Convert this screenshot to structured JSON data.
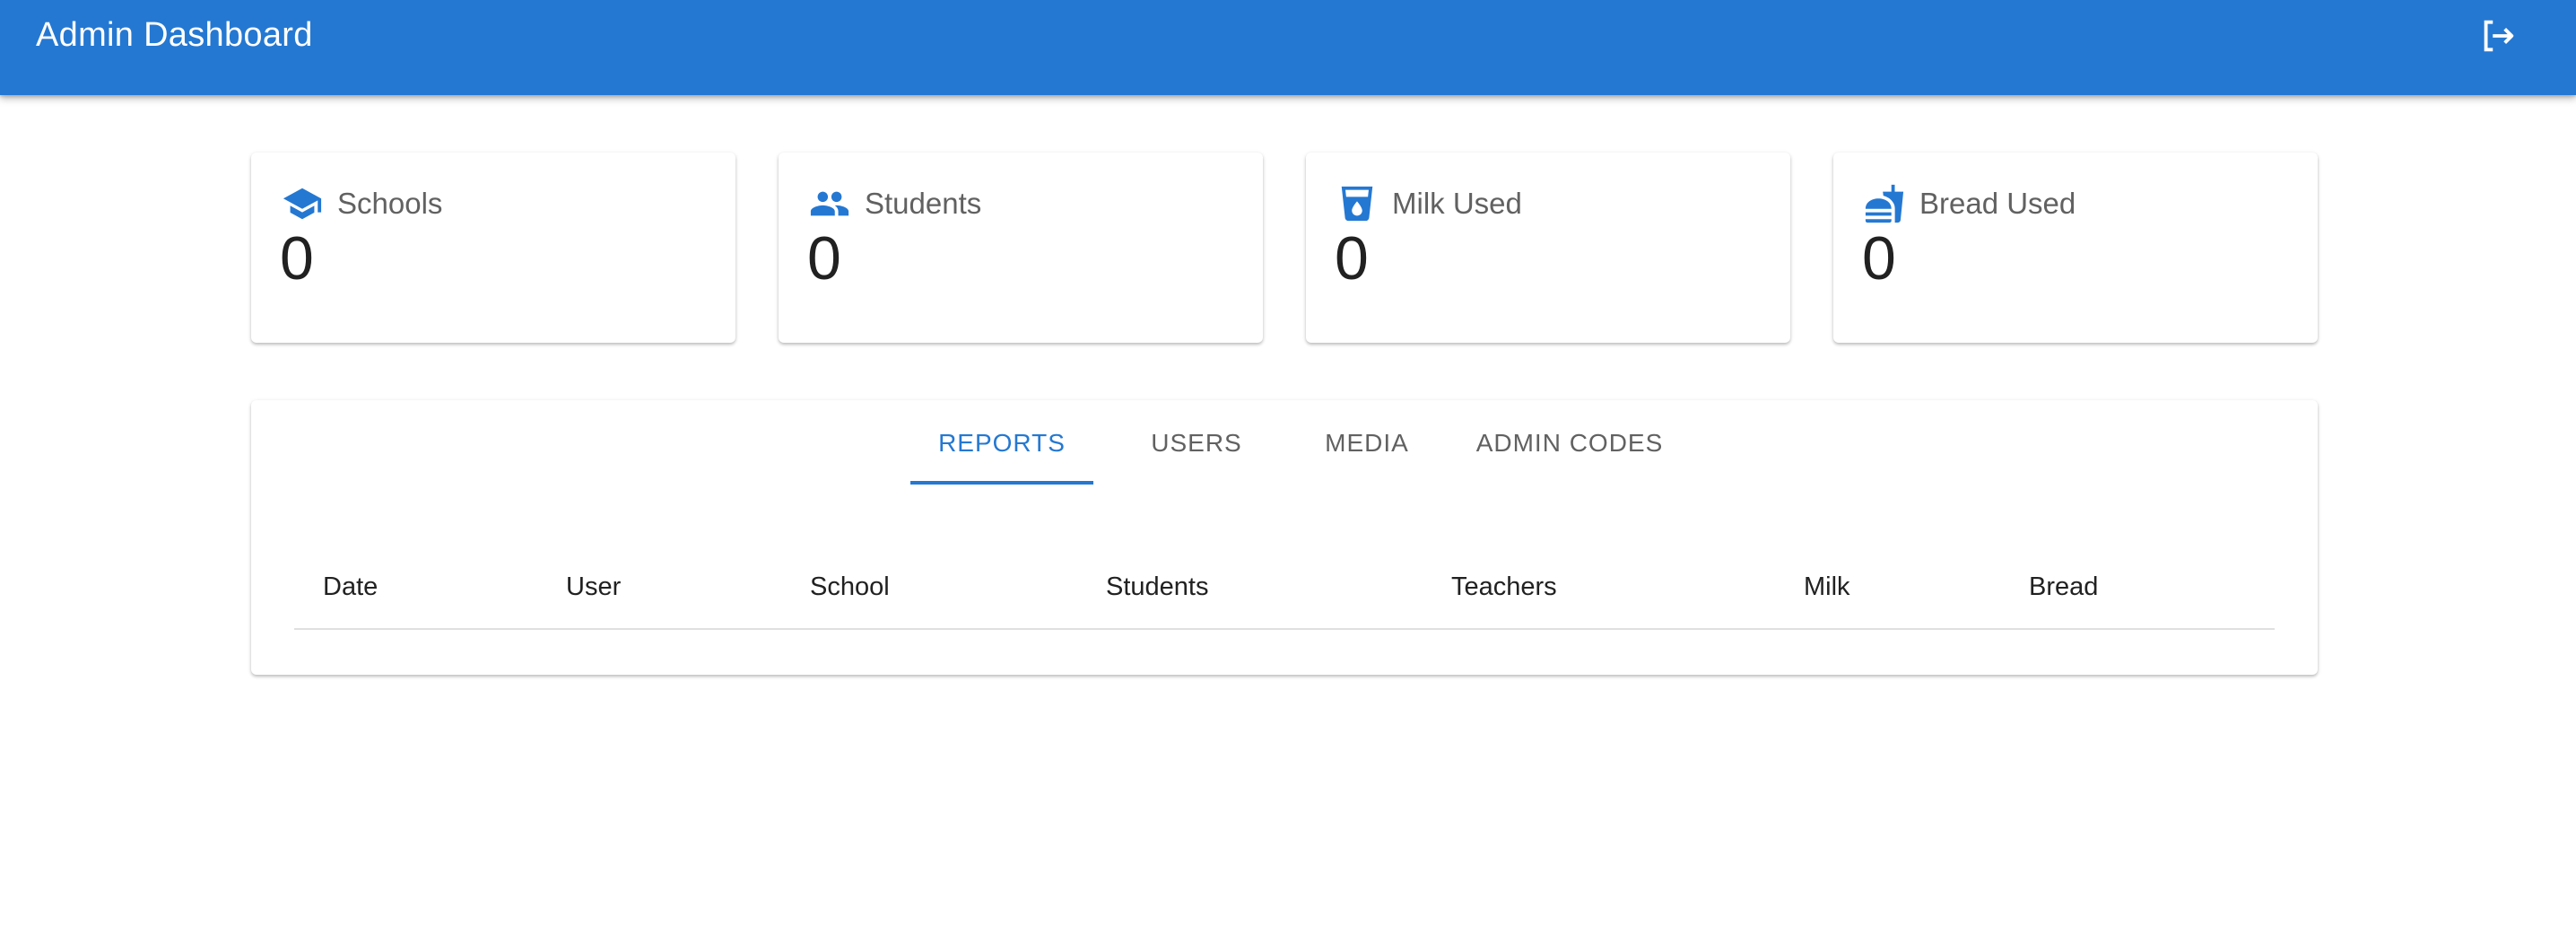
{
  "app": {
    "title": "Admin Dashboard",
    "logout_icon": "logout-icon"
  },
  "stats": [
    {
      "label": "Schools",
      "value": "0",
      "icon": "school-icon"
    },
    {
      "label": "Students",
      "value": "0",
      "icon": "people-icon"
    },
    {
      "label": "Milk Used",
      "value": "0",
      "icon": "local-drink-icon"
    },
    {
      "label": "Bread Used",
      "value": "0",
      "icon": "fastfood-icon"
    }
  ],
  "tabs": [
    {
      "label": "REPORTS",
      "active": true
    },
    {
      "label": "USERS",
      "active": false
    },
    {
      "label": "MEDIA",
      "active": false
    },
    {
      "label": "ADMIN CODES",
      "active": false
    }
  ],
  "table": {
    "columns": [
      "Date",
      "User",
      "School",
      "Students",
      "Teachers",
      "Milk",
      "Bread"
    ],
    "rows": []
  },
  "colors": {
    "primary": "#2478d2",
    "text": "#212121",
    "muted": "#616161"
  }
}
